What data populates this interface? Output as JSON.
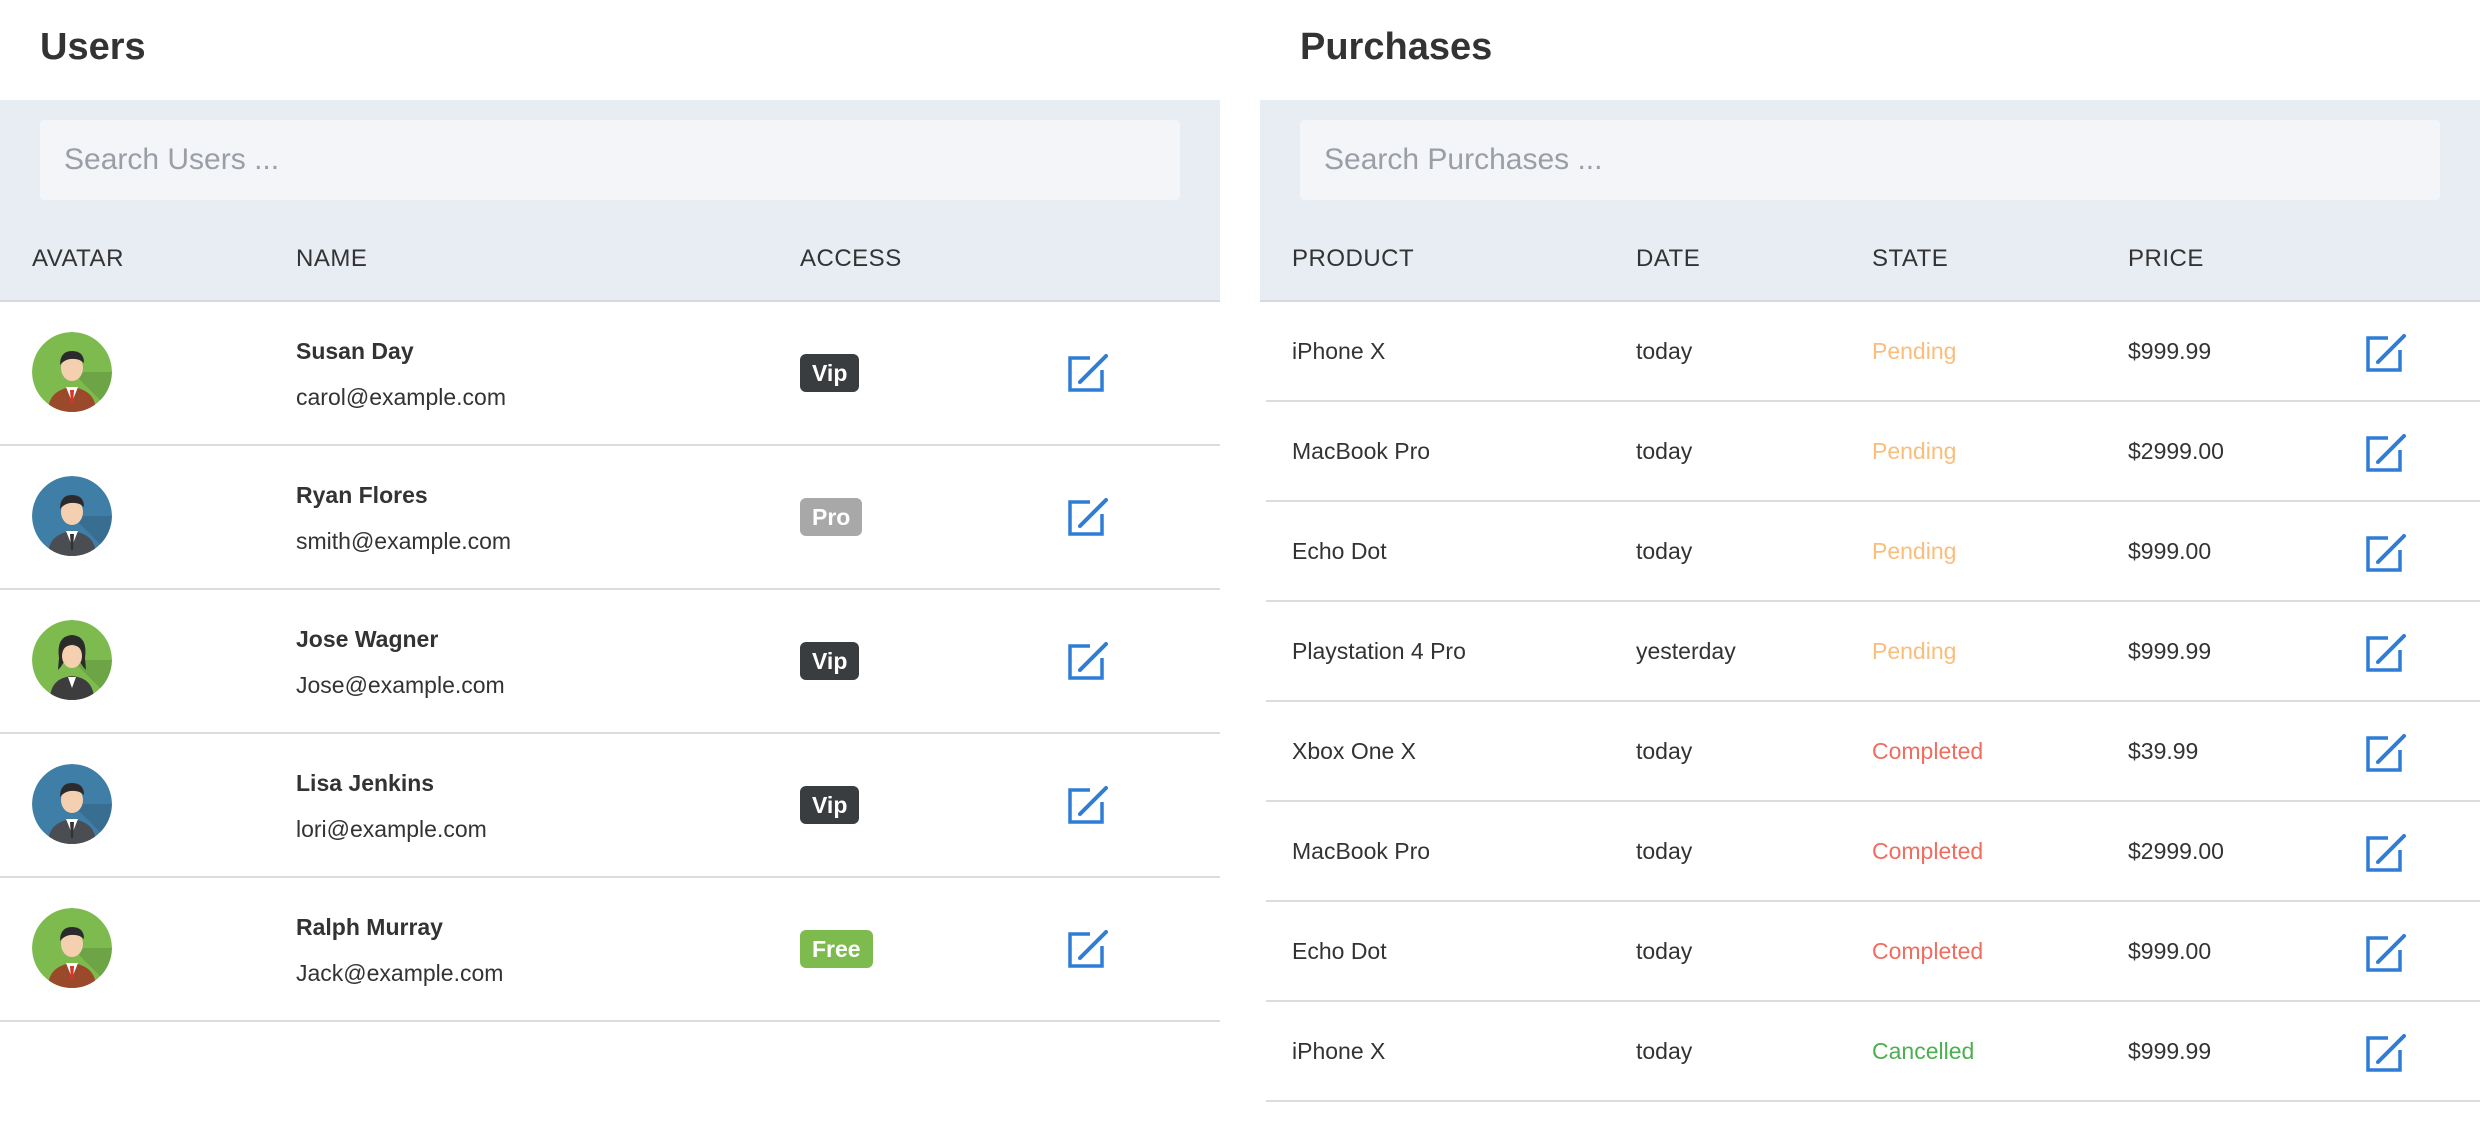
{
  "users_panel": {
    "title": "Users",
    "search_placeholder": "Search Users ...",
    "columns": {
      "avatar": "AVATAR",
      "name": "NAME",
      "access": "ACCESS"
    },
    "rows": [
      {
        "name": "Susan Day",
        "email": "carol@example.com",
        "access": "Vip",
        "avatar": "male-avatar-red-tie",
        "avatar_bg": "#7dbb4f"
      },
      {
        "name": "Ryan Flores",
        "email": "smith@example.com",
        "access": "Pro",
        "avatar": "male-avatar-dark-suit",
        "avatar_bg": "#3f7ea6"
      },
      {
        "name": "Jose Wagner",
        "email": "Jose@example.com",
        "access": "Vip",
        "avatar": "female-avatar",
        "avatar_bg": "#7dbb4f"
      },
      {
        "name": "Lisa Jenkins",
        "email": "lori@example.com",
        "access": "Vip",
        "avatar": "male-avatar-dark-suit",
        "avatar_bg": "#3f7ea6"
      },
      {
        "name": "Ralph Murray",
        "email": "Jack@example.com",
        "access": "Free",
        "avatar": "male-avatar-red-tie",
        "avatar_bg": "#7dbb4f"
      }
    ]
  },
  "purchases_panel": {
    "title": "Purchases",
    "search_placeholder": "Search Purchases ...",
    "columns": {
      "product": "PRODUCT",
      "date": "DATE",
      "state": "STATE",
      "price": "PRICE"
    },
    "rows": [
      {
        "product": "iPhone X",
        "date": "today",
        "state": "Pending",
        "price": "$999.99"
      },
      {
        "product": "MacBook Pro",
        "date": "today",
        "state": "Pending",
        "price": "$2999.00"
      },
      {
        "product": "Echo Dot",
        "date": "today",
        "state": "Pending",
        "price": "$999.00"
      },
      {
        "product": "Playstation 4 Pro",
        "date": "yesterday",
        "state": "Pending",
        "price": "$999.99"
      },
      {
        "product": "Xbox One X",
        "date": "today",
        "state": "Completed",
        "price": "$39.99"
      },
      {
        "product": "MacBook Pro",
        "date": "today",
        "state": "Completed",
        "price": "$2999.00"
      },
      {
        "product": "Echo Dot",
        "date": "today",
        "state": "Completed",
        "price": "$999.00"
      },
      {
        "product": "iPhone X",
        "date": "today",
        "state": "Cancelled",
        "price": "$999.99"
      }
    ]
  },
  "colors": {
    "accent_blue": "#2f7dd6",
    "header_band": "#e8ecf3",
    "state_pending": "#fbbd7a",
    "state_completed": "#f06d5f",
    "state_cancelled": "#4caf50",
    "badge_vip": "#3a3d40",
    "badge_pro": "#a8a8a8",
    "badge_free": "#7dbb4f"
  },
  "icons": {
    "edit": "edit-icon"
  }
}
